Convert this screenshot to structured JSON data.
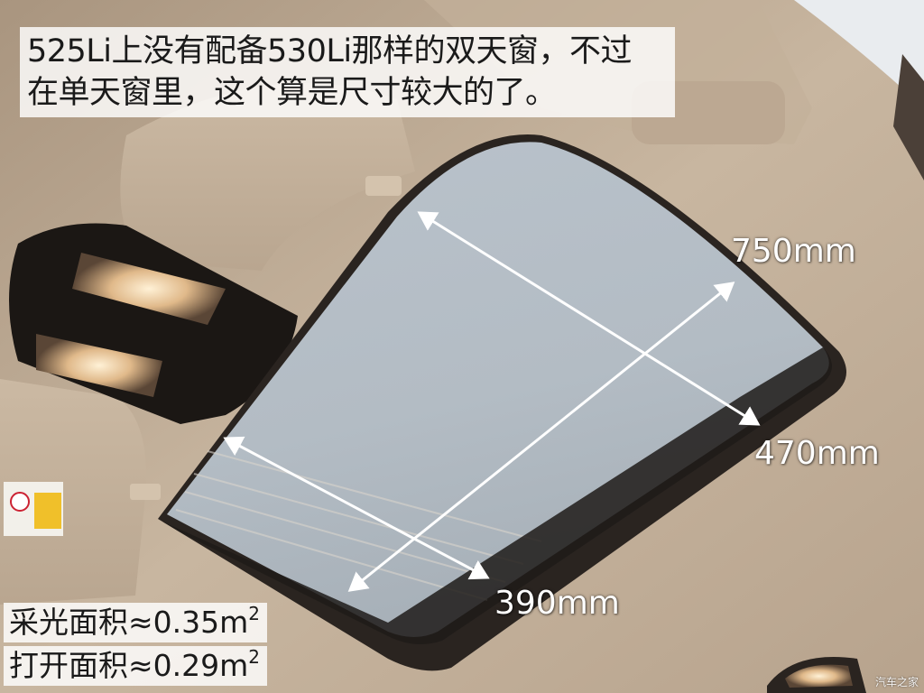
{
  "caption": {
    "line1": "525Li上没有配备530Li那样的双天窗，不过",
    "line2": "在单天窗里，这个算是尺寸较大的了。"
  },
  "dimensions": {
    "diagonal": "750mm",
    "width": "470mm",
    "length": "390mm"
  },
  "areas": {
    "light_label": "采光面积≈0.35m",
    "light_exp": "2",
    "open_label": "打开面积≈0.29m",
    "open_exp": "2"
  },
  "watermark": "汽车之家",
  "colors": {
    "headliner": "#c9b8a2",
    "glass": "#b6bfc7",
    "arrow": "#ffffff"
  }
}
